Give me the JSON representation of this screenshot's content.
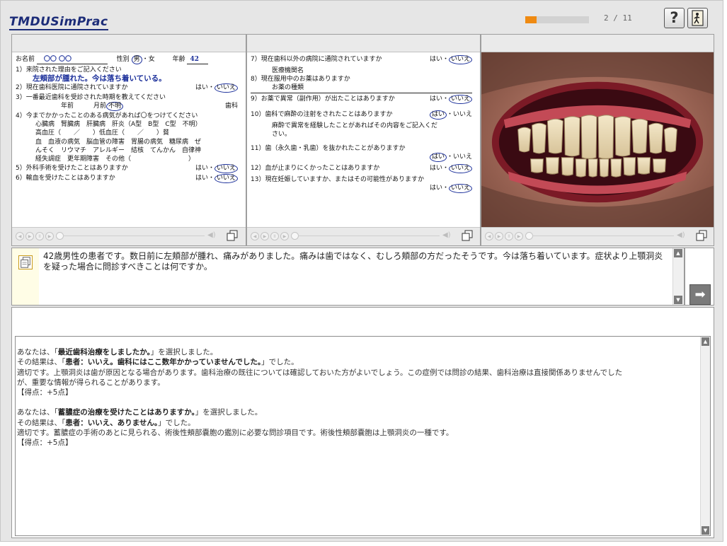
{
  "app": {
    "logo": "TMDUSimPrac"
  },
  "progress": {
    "value": 0.18,
    "text": "2 / 11"
  },
  "header": {
    "help_label": "?"
  },
  "form_left": {
    "name_label": "お名前",
    "name_value": "〇〇 〇〇",
    "sex_label": "性別",
    "sex_male": "男",
    "sex_sep": "・",
    "sex_female": "女",
    "age_label": "年齢",
    "age_value": "42",
    "q1": "1）来院された理由をご記入ください",
    "a1": "左頬部が腫れた。今は落ち着いている。",
    "q2": "2）現在歯科医院に通院されていますか",
    "q2_yes": "はい",
    "q2_sep": "・",
    "q2_no": "いいえ",
    "q3": "3）一番最近歯科を受診された時期を教えてください",
    "q3_years": "年前",
    "q3_months": "月前",
    "q3_unknown": "不明",
    "q3_dental": "歯科",
    "q4": "4）今までかかったことのある病気があれば〇をつけてください",
    "q4_l1": "心臓病　腎臓病　肝臓病　肝炎（A型　B型　C型　不明）",
    "q4_l2": "高血圧（　　／　　）低血圧（　　／　　）貧",
    "q4_l3": "血　血液の病気　脳血管の障害　胃腸の病気　糖尿病　ぜ",
    "q4_l4": "んそく　リウマチ　アレルギー　結核　てんかん　自律神",
    "q4_l5": "経失調症　更年期障害　その他（　　　　　　　　　）",
    "q5": "5）外科手術を受けたことはありますか",
    "q5_yes": "はい",
    "q5_sep": "・",
    "q5_no": "いいえ",
    "q6": "6）輸血を受けたことはありますか",
    "q6_yes": "はい",
    "q6_sep": "・",
    "q6_no": "いいえ"
  },
  "form_mid": {
    "q7": "7）現在歯科以外の病院に通院されていますか",
    "q7_yes": "はい",
    "q7_sep": "・",
    "q7_no": "いいえ",
    "q7_sub": "医療機関名",
    "q8": "8）現在服用中のお薬はありますか",
    "q8_sub": "お薬の種類",
    "q9": "9）お薬で異常（副作用）が出たことはありますか",
    "q9_yes": "はい",
    "q9_sep": "・",
    "q9_no": "いいえ",
    "q10": "10）歯科で麻酔の注射をされたことはありますか",
    "q10_yes": "はい",
    "q10_sep": "・",
    "q10_no": "いいえ",
    "q10_sub1": "麻酔で異常を経験したことがあればその内容をご記入くだ",
    "q10_sub2": "さい。",
    "q11": "11）歯（永久歯・乳歯）を抜かれたことがありますか",
    "q11_yes": "はい",
    "q11_sep": "・",
    "q11_no": "いいえ",
    "q12": "12）血が止まりにくかったことはありますか",
    "q12_yes": "はい",
    "q12_sep": "・",
    "q12_no": "いいえ",
    "q13": "13）現在妊娠していますか、またはその可能性がありますか",
    "q13_yes": "はい",
    "q13_sep": "・",
    "q13_no": "いいえ"
  },
  "question": {
    "text": "42歳男性の患者です。数日前に左頬部が腫れ、痛みがありました。痛みは歯ではなく、むしろ頬部の方だったそうです。今は落ち着いています。症状より上顎洞炎を疑った場合に問診すべきことは何ですか。"
  },
  "results": [
    {
      "l1a": "あなたは、「",
      "l1b": "最近歯科治療をしましたか。",
      "l1c": "」を選択しました。",
      "l2a": "その結果は、「",
      "l2b": "患者：いいえ。歯科にはここ数年かかっていませんでした。",
      "l2c": "」でした。",
      "l3": "適切です。上顎洞炎は歯が原因となる場合があります。歯科治療の既往については確認しておいた方がよいでしょう。この症例では問診の結果、歯科治療は直接関係ありませんでした",
      "l4": "が、重要な情報が得られることがあります。",
      "l5": "【得点：+5点】"
    },
    {
      "l1a": "あなたは、「",
      "l1b": "蓄膿症の治療を受けたことはありますか。",
      "l1c": "」を選択しました。",
      "l2a": "その結果は、「",
      "l2b": "患者：いいえ、ありません。",
      "l2c": "」でした。",
      "l3": "適切です。蓄膿症の手術のあとに見られる、術後性頬部嚢胞の鑑別に必要な問診項目です。術後性頬部嚢胞は上顎洞炎の一種です。",
      "l5": "【得点：+5点】"
    }
  ],
  "colors": {
    "accent": "#ef8a12",
    "ink": "#1b2f9a",
    "logo": "#1c2c78"
  },
  "icons": {
    "help": "help-icon",
    "exit": "exit-door-icon",
    "question": "question-document-icon",
    "next": "next-arrow-icon"
  }
}
